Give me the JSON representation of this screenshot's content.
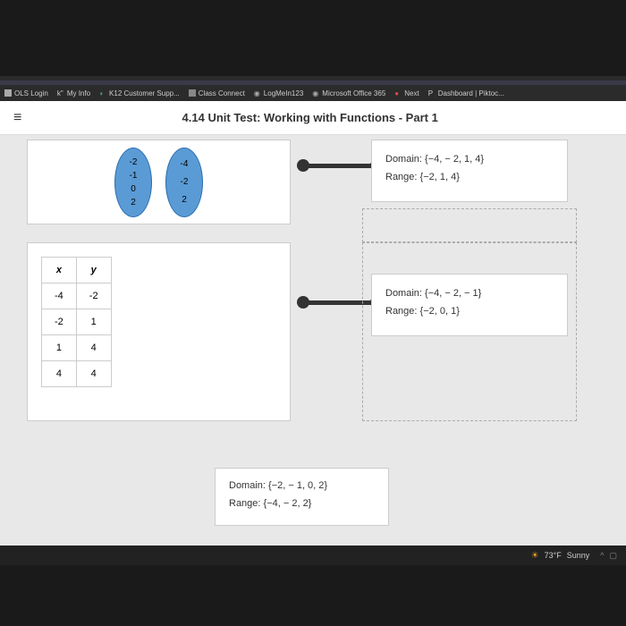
{
  "bookmarks": [
    {
      "label": "OLS Login"
    },
    {
      "label": "My Info"
    },
    {
      "label": "K12 Customer Supp..."
    },
    {
      "label": "Class Connect"
    },
    {
      "label": "LogMeIn123"
    },
    {
      "label": "Microsoft Office 365"
    },
    {
      "label": "Next"
    },
    {
      "label": "Dashboard | Piktoc..."
    }
  ],
  "header": {
    "title": "4.14 Unit Test: Working with Functions - Part 1"
  },
  "mapping": {
    "left": [
      "-2",
      "-1",
      "0",
      "2"
    ],
    "right": [
      "-4",
      "-2",
      "2"
    ]
  },
  "table": {
    "headers": [
      "x",
      "y"
    ],
    "rows": [
      [
        "-4",
        "-2"
      ],
      [
        "-2",
        "1"
      ],
      [
        "1",
        "4"
      ],
      [
        "4",
        "4"
      ]
    ]
  },
  "answers": {
    "top": {
      "domain": "Domain: {−4, − 2, 1, 4}",
      "range": "Range: {−2, 1, 4}"
    },
    "mid": {
      "domain": "Domain: {−4, − 2, − 1}",
      "range": "Range: {−2, 0, 1}"
    },
    "bottom": {
      "domain": "Domain: {−2, − 1, 0, 2}",
      "range": "Range: {−4, − 2, 2}"
    }
  },
  "weather": {
    "temp": "73°F",
    "condition": "Sunny"
  }
}
